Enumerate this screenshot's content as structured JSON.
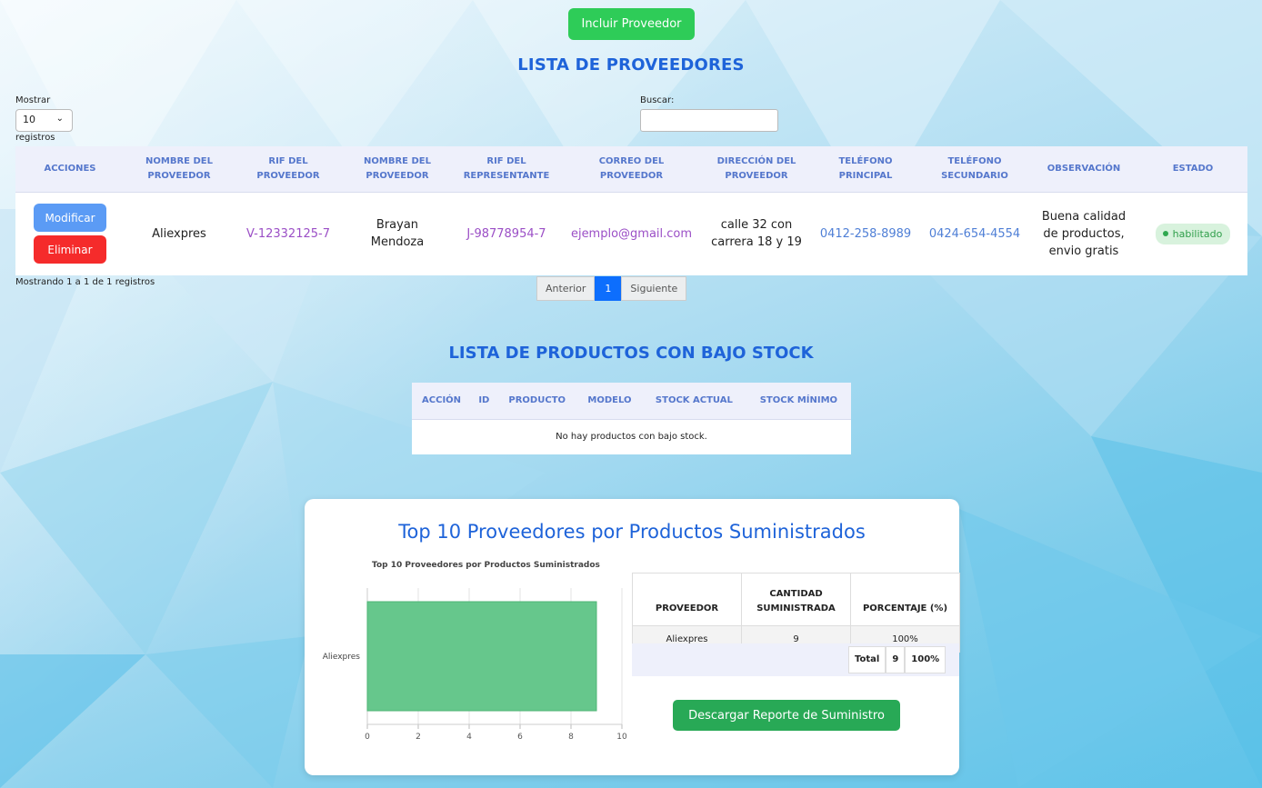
{
  "toolbar": {
    "include_label": "Incluir Proveedor"
  },
  "providers_section": {
    "title": "LISTA DE PROVEEDORES",
    "length": {
      "label_before": "Mostrar",
      "value": "10",
      "label_after": "registros"
    },
    "search": {
      "label": "Buscar:",
      "value": "",
      "placeholder": ""
    },
    "columns": [
      "ACCIONES",
      "NOMBRE DEL PROVEEDOR",
      "RIF DEL PROVEEDOR",
      "NOMBRE DEL PROVEEDOR",
      "RIF DEL REPRESENTANTE",
      "CORREO DEL PROVEEDOR",
      "DIRECCIÓN DEL PROVEEDOR",
      "TELÉFONO PRINCIPAL",
      "TELÉFONO SECUNDARIO",
      "OBSERVACIÓN",
      "ESTADO"
    ],
    "rows": [
      {
        "modify_label": "Modificar",
        "delete_label": "Eliminar",
        "provider_name": "Aliexpres",
        "provider_rif": "V-12332125-7",
        "representative_name": "Brayan Mendoza",
        "representative_rif": "J-98778954-7",
        "email": "ejemplo@gmail.com",
        "address": "calle 32 con carrera 18 y 19",
        "phone_main": "0412-258-8989",
        "phone_secondary": "0424-654-4554",
        "observation": "Buena calidad de productos, envio gratis",
        "status": "habilitado"
      }
    ],
    "info": "Mostrando 1 a 1 de 1 registros",
    "pagination": {
      "prev": "Anterior",
      "current": "1",
      "next": "Siguiente"
    }
  },
  "low_stock_section": {
    "title": "LISTA DE PRODUCTOS CON BAJO STOCK",
    "columns": [
      "ACCIÓN",
      "ID",
      "PRODUCTO",
      "MODELO",
      "STOCK ACTUAL",
      "STOCK MÍNIMO"
    ],
    "empty_message": "No hay productos con bajo stock."
  },
  "top_section": {
    "title": "Top 10 Proveedores por Productos Suministrados",
    "table": {
      "columns": [
        "PROVEEDOR",
        "CANTIDAD SUMINISTRADA",
        "PORCENTAJE (%)"
      ],
      "rows": [
        {
          "provider": "Aliexpres",
          "quantity": "9",
          "percent": "100%"
        }
      ],
      "total": {
        "label": "Total",
        "quantity": "9",
        "percent": "100%"
      }
    },
    "download_label": "Descargar Reporte de Suministro"
  },
  "colors": {
    "accent_blue": "#1e63d9",
    "include_green": "#2ecc58",
    "modify_blue": "#5b9bf5",
    "delete_red": "#f52b2b",
    "bar_green": "#66c78c",
    "status_green": "#2f9e4a"
  },
  "chart_data": {
    "type": "bar",
    "orientation": "horizontal",
    "title": "Top 10 Proveedores por Productos Suministrados",
    "categories": [
      "Aliexpres"
    ],
    "values": [
      9
    ],
    "xlim": [
      0,
      10
    ],
    "xticks": [
      "0",
      "2",
      "4",
      "6",
      "8",
      "10"
    ],
    "grid": true,
    "legend": "none"
  }
}
